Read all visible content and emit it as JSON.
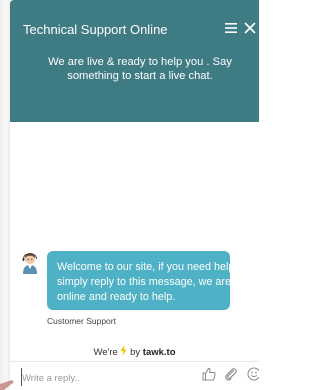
{
  "header": {
    "title": "Technical Support Online",
    "subtitle": "We are live & ready to help you . Say something to start a live chat."
  },
  "message": {
    "lines": [
      "Welcome to our site, if you need help",
      "simply reply to this message, we are",
      "online and ready to help."
    ],
    "author": "Customer Support"
  },
  "footer": {
    "powered_prefix": "We're",
    "powered_by": "by",
    "brand": "tawk.to"
  },
  "composer": {
    "placeholder": "Write a reply..",
    "value": ""
  },
  "icons": {
    "menu": "hamburger-menu-icon",
    "close": "close-icon",
    "avatar": "agent-avatar-icon",
    "bolt": "lightning-bolt-icon",
    "rate": "thumbs-up-icon",
    "attach": "paperclip-icon",
    "emoji": "smiley-icon"
  },
  "colors": {
    "header_bg": "#3e7b83",
    "bubble_bg": "#4eb1c5",
    "bolt": "#f2c200"
  }
}
